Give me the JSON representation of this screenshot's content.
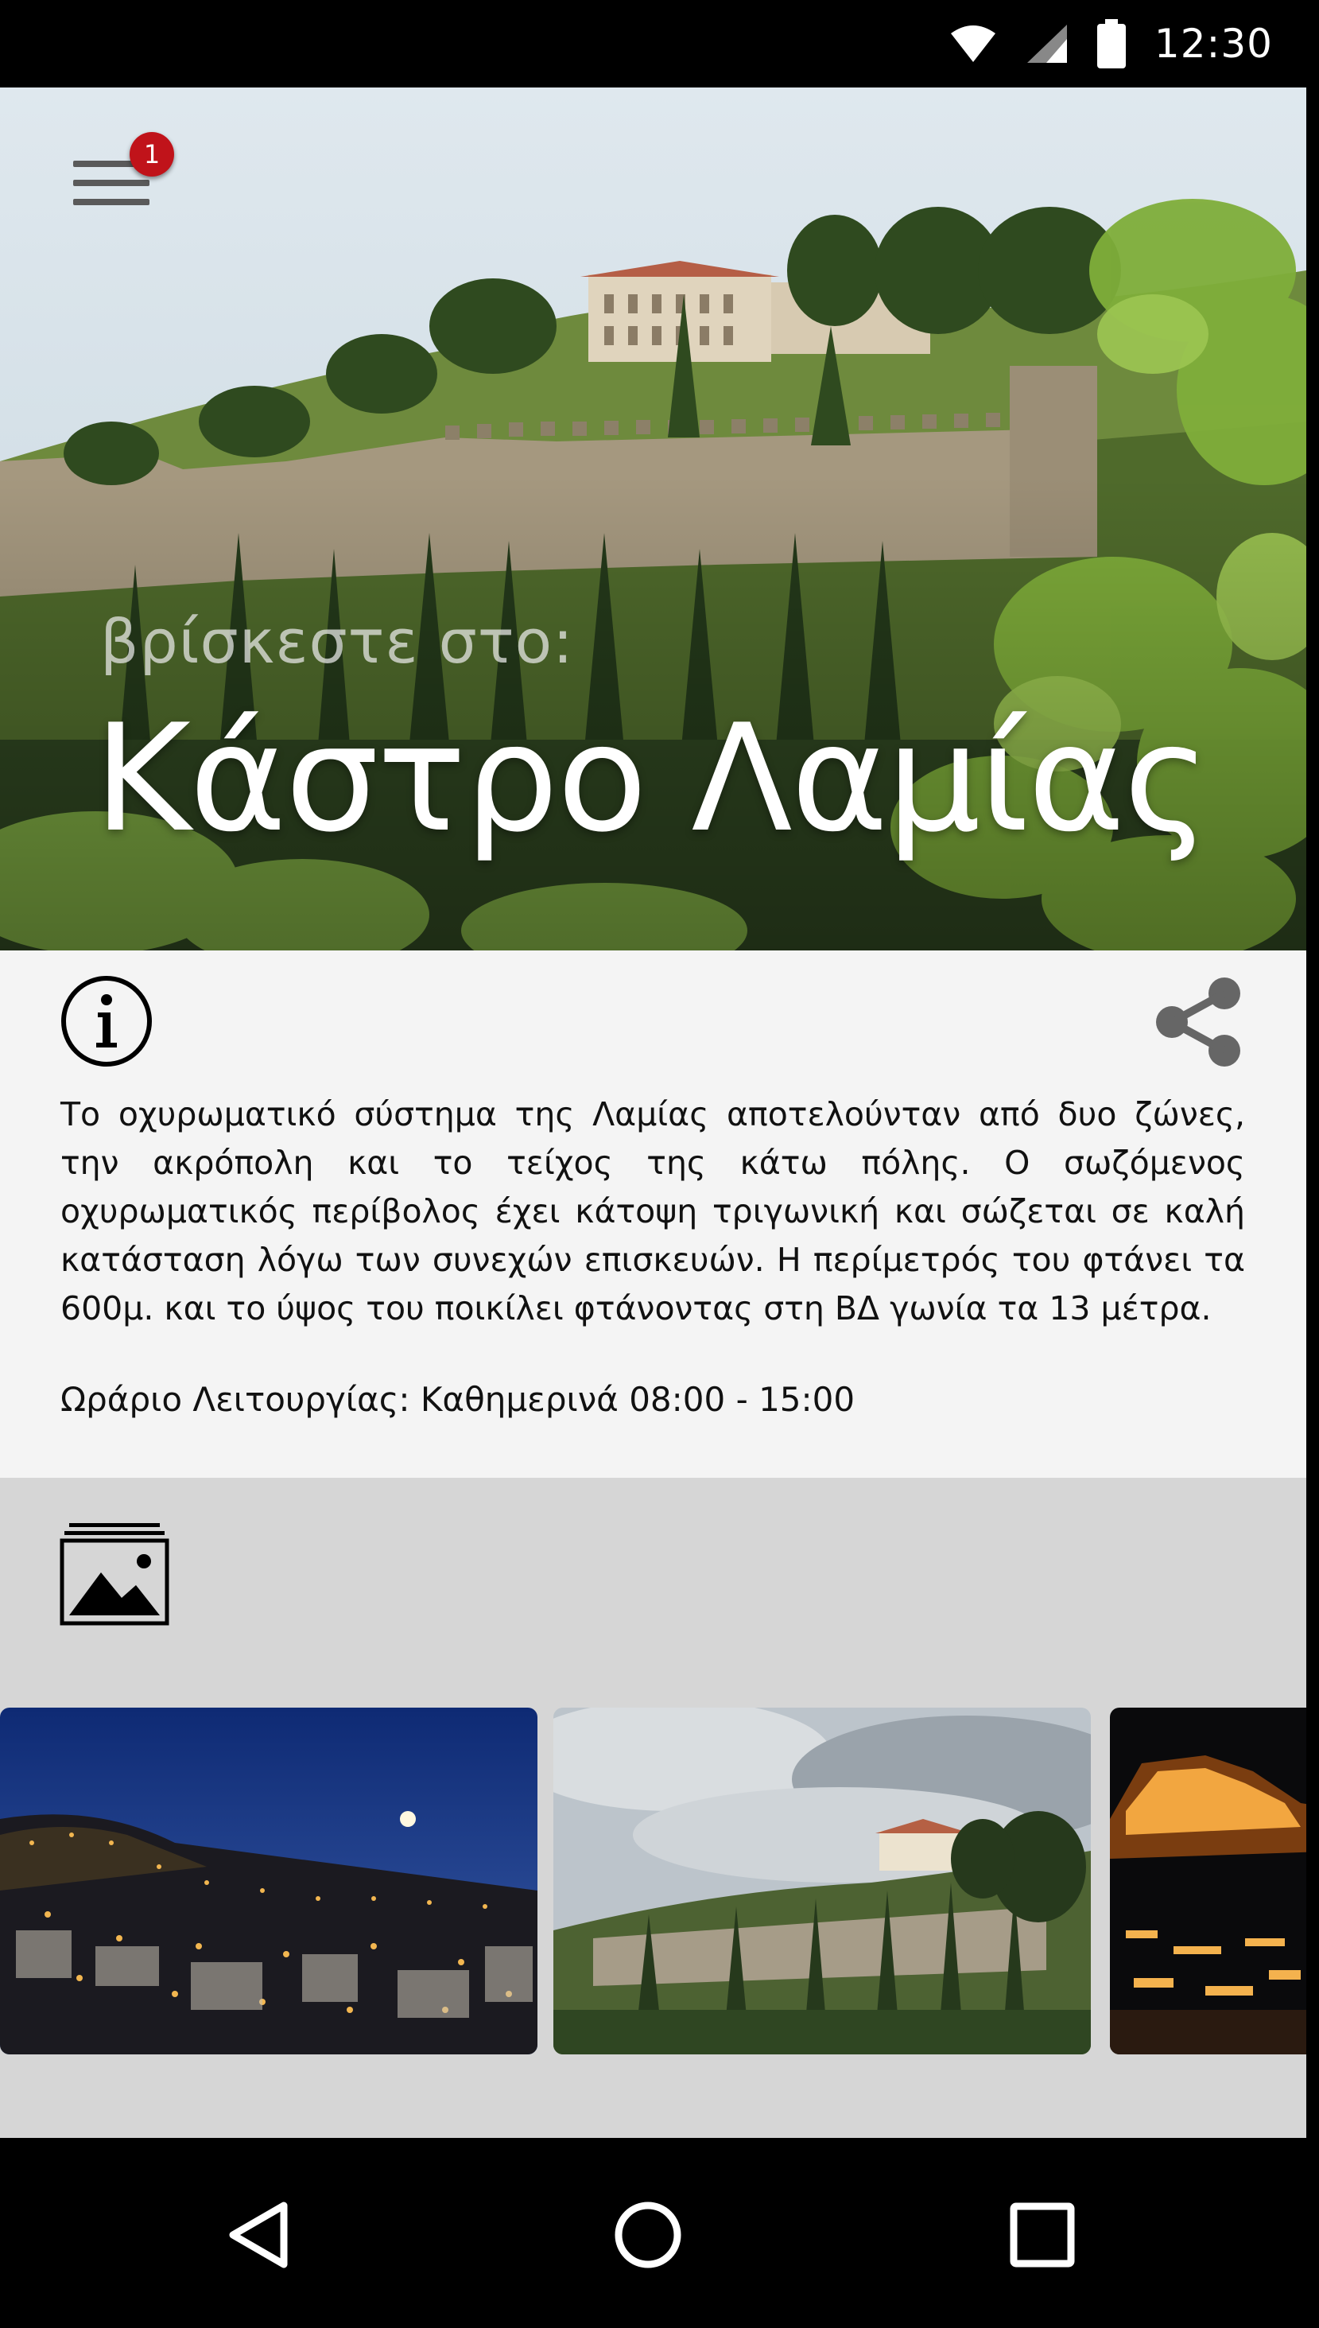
{
  "status_bar": {
    "time": "12:30",
    "icons": [
      "wifi-icon",
      "signal-icon",
      "battery-icon"
    ]
  },
  "header": {
    "menu_icon": "hamburger-menu-icon",
    "notification_count": "1"
  },
  "hero": {
    "subtitle": "βρίσκεστε στο:",
    "title": "Κάστρο Λαμίας"
  },
  "info": {
    "info_icon": "info-icon",
    "share_icon": "share-icon",
    "description": "Το οχυρωματικό σύστημα της Λαμίας αποτελούνταν από δυο ζώνες, την ακρόπολη και το τείχος της κάτω πόλης. Ο σωζόμενος οχυρωματικός περίβολος έχει κάτοψη τριγωνική και σώζεται σε καλή κατάσταση λόγω των συνεχών επισκευών. Η περίμετρός του φτάνει τα 600μ. και το ύψος του ποικίλει φτάνοντας στη ΒΔ γωνία τα 13 μέτρα.",
    "hours": "Ωράριο Λειτουργίας: Καθημερινά 08:00 - 15:00"
  },
  "gallery": {
    "icon": "gallery-icon",
    "photos": [
      "city-night-photo",
      "castle-day-photo",
      "castle-night-photo"
    ]
  },
  "nav_bar": {
    "buttons": [
      "back-icon",
      "home-icon",
      "recents-icon"
    ]
  },
  "colors": {
    "badge": "#c0131a",
    "info_bg": "#f4f4f4",
    "gallery_bg": "#d6d6d6"
  }
}
